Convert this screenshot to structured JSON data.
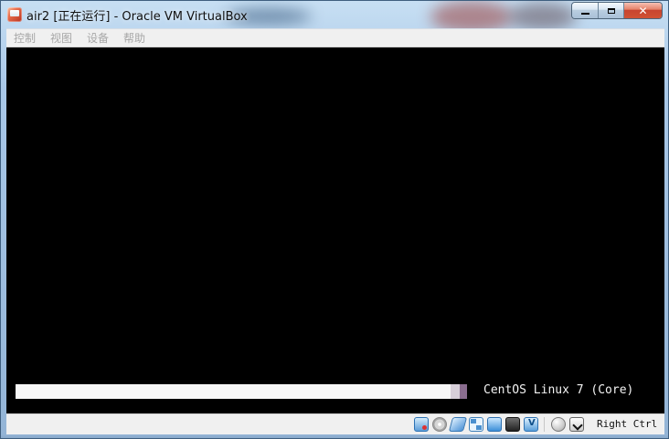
{
  "window": {
    "title": "air2 [正在运行] - Oracle VM VirtualBox",
    "title_icon": "virtualbox-icon",
    "controls": {
      "minimize_icon": "minimize-icon",
      "maximize_icon": "maximize-icon",
      "close_icon": "close-icon"
    }
  },
  "menubar": {
    "items": [
      {
        "label": "控制"
      },
      {
        "label": "视图"
      },
      {
        "label": "设备"
      },
      {
        "label": "帮助"
      }
    ]
  },
  "vm_screen": {
    "boot_message": "CentOS Linux 7 (Core)",
    "progress_fraction": 1.0
  },
  "statusbar": {
    "icons": [
      "hard-disk-icon",
      "optical-drive-icon",
      "usb-icon",
      "network-icon",
      "shared-folder-icon",
      "display-icon",
      "virtualization-icon",
      "mouse-integration-icon",
      "keyboard-capture-icon"
    ],
    "host_key": "Right Ctrl"
  },
  "colors": {
    "screen_background": "#000000",
    "progress_bar": "#f7f7f7",
    "progress_tail_light": "#d7cfd9",
    "progress_tail_dark": "#8a6d8f",
    "menu_disabled_text": "#a7a7a7"
  }
}
